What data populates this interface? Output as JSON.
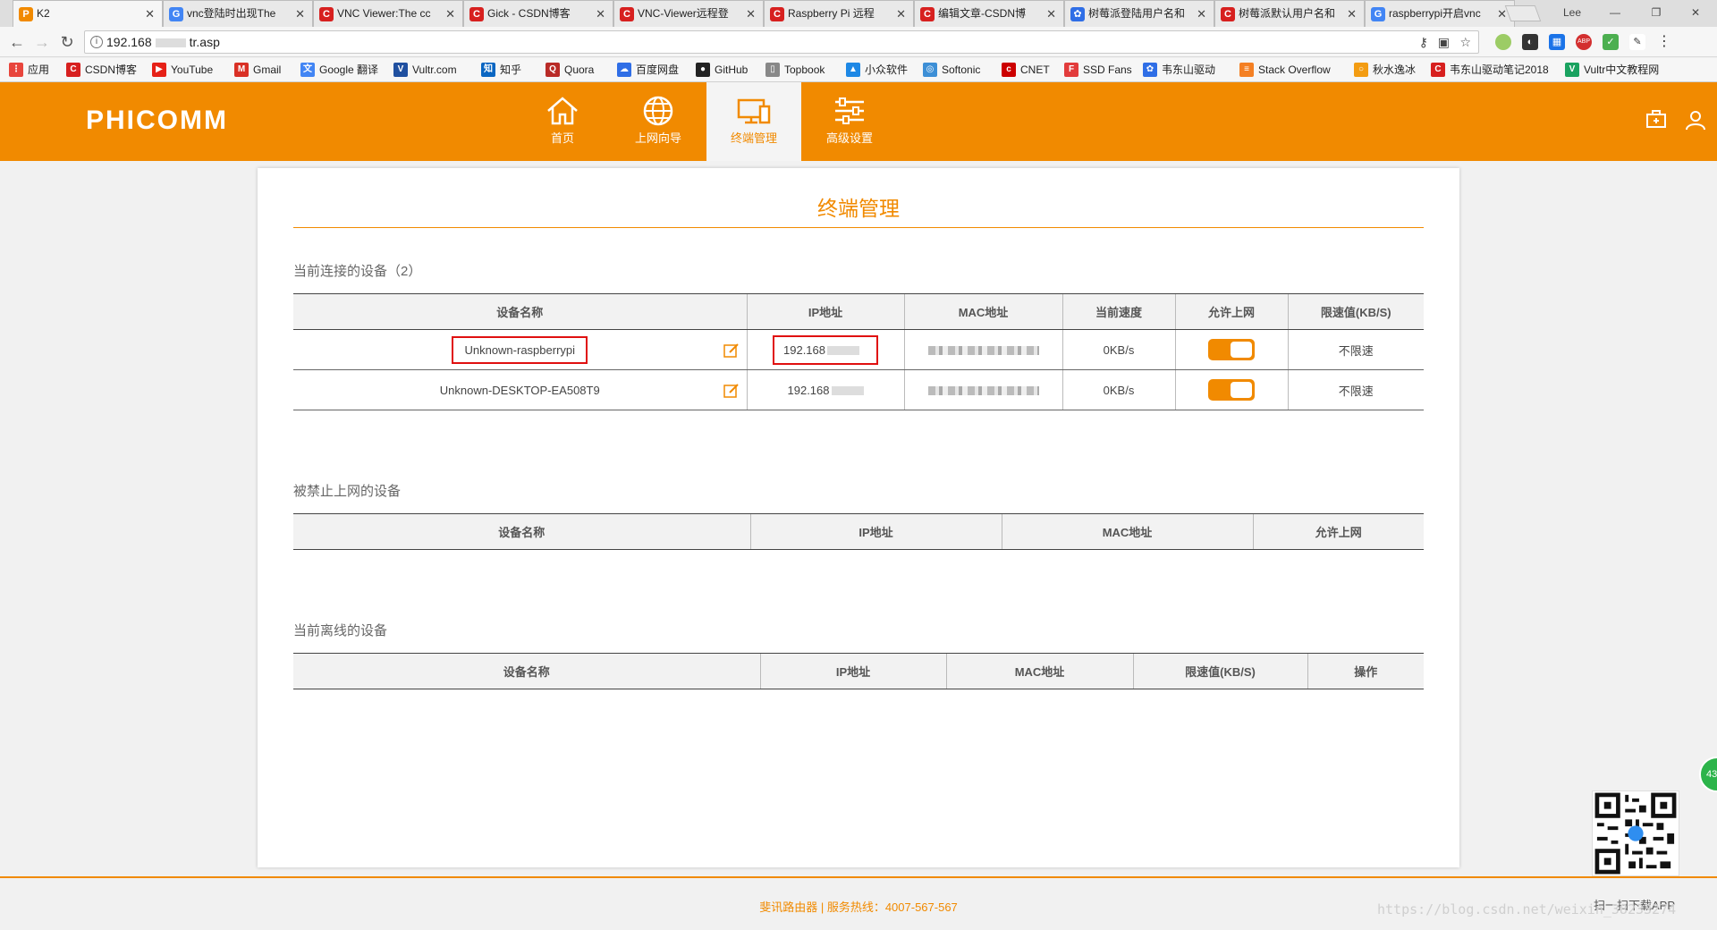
{
  "browser": {
    "tabs": [
      {
        "title": "K2",
        "icon": "phicomm-p-icon",
        "color": "#f18a00",
        "glyph": "P"
      },
      {
        "title": "vnc登陆时出现The",
        "icon": "google-g-icon",
        "color": "#4285f4",
        "glyph": "G"
      },
      {
        "title": "VNC Viewer:The cc",
        "icon": "csdn-c-icon",
        "color": "#d7201f",
        "glyph": "C"
      },
      {
        "title": "Gick - CSDN博客",
        "icon": "csdn-c-icon",
        "color": "#d7201f",
        "glyph": "C"
      },
      {
        "title": "VNC-Viewer远程登",
        "icon": "csdn-c-icon",
        "color": "#d7201f",
        "glyph": "C"
      },
      {
        "title": "Raspberry Pi 远程",
        "icon": "csdn-c-icon",
        "color": "#d7201f",
        "glyph": "C"
      },
      {
        "title": "编辑文章-CSDN博",
        "icon": "csdn-c-icon",
        "color": "#d7201f",
        "glyph": "C"
      },
      {
        "title": "树莓派登陆用户名和",
        "icon": "baidu-paw-icon",
        "color": "#2f6ee6",
        "glyph": "✿"
      },
      {
        "title": "树莓派默认用户名和",
        "icon": "csdn-c-icon",
        "color": "#d7201f",
        "glyph": "C"
      },
      {
        "title": "raspberrypi开启vnc",
        "icon": "google-g-icon",
        "color": "#4285f4",
        "glyph": "G"
      }
    ],
    "profile": "Lee",
    "url_prefix": "192.168",
    "url_suffix": "tr.asp",
    "bookmarks": [
      {
        "label": "应用",
        "icon": "apps-grid-icon",
        "color": "#e8453c",
        "glyph": "⋮"
      },
      {
        "label": "CSDN博客",
        "icon": "csdn-c-icon",
        "color": "#d7201f",
        "glyph": "C"
      },
      {
        "label": "YouTube",
        "icon": "youtube-icon",
        "color": "#e62117",
        "glyph": "▶"
      },
      {
        "label": "Gmail",
        "icon": "gmail-icon",
        "color": "#d93025",
        "glyph": "M"
      },
      {
        "label": "Google 翻译",
        "icon": "translate-icon",
        "color": "#4285f4",
        "glyph": "文"
      },
      {
        "label": "Vultr.com",
        "icon": "vultr-icon",
        "color": "#2050a0",
        "glyph": "V"
      },
      {
        "label": "知乎",
        "icon": "zhihu-icon",
        "color": "#0a66c2",
        "glyph": "知"
      },
      {
        "label": "Quora",
        "icon": "quora-icon",
        "color": "#b92b27",
        "glyph": "Q"
      },
      {
        "label": "百度网盘",
        "icon": "baidu-pan-icon",
        "color": "#2f6ee6",
        "glyph": "☁"
      },
      {
        "label": "GitHub",
        "icon": "github-icon",
        "color": "#222222",
        "glyph": "●"
      },
      {
        "label": "Topbook",
        "icon": "page-icon",
        "color": "#888888",
        "glyph": "▯"
      },
      {
        "label": "小众软件",
        "icon": "appinn-icon",
        "color": "#1e88e5",
        "glyph": "▲"
      },
      {
        "label": "Softonic",
        "icon": "softonic-icon",
        "color": "#3d8fd6",
        "glyph": "◎"
      },
      {
        "label": "CNET",
        "icon": "cnet-icon",
        "color": "#cc0000",
        "glyph": "c"
      },
      {
        "label": "SSD Fans",
        "icon": "ssdfans-icon",
        "color": "#e23c3c",
        "glyph": "F"
      },
      {
        "label": "韦东山驱动",
        "icon": "baidu-paw-icon",
        "color": "#2f6ee6",
        "glyph": "✿"
      },
      {
        "label": "Stack Overflow",
        "icon": "stackoverflow-icon",
        "color": "#f48024",
        "glyph": "≡"
      },
      {
        "label": "秋水逸冰",
        "icon": "circle-icon",
        "color": "#f39c12",
        "glyph": "○"
      },
      {
        "label": "韦东山驱动笔记2018",
        "icon": "csdn-c-icon",
        "color": "#d7201f",
        "glyph": "C"
      },
      {
        "label": "Vultr中文教程网",
        "icon": "vultr-cn-icon",
        "color": "#1aa260",
        "glyph": "V"
      }
    ]
  },
  "router": {
    "logo": "PHICOMM",
    "nav": [
      {
        "label": "首页",
        "icon": "home-icon",
        "active": false
      },
      {
        "label": "上网向导",
        "icon": "globe-icon",
        "active": false
      },
      {
        "label": "终端管理",
        "icon": "devices-icon",
        "active": true
      },
      {
        "label": "高级设置",
        "icon": "sliders-icon",
        "active": false
      }
    ],
    "accent": "#f18a00"
  },
  "page": {
    "title": "终端管理",
    "connected": {
      "title": "当前连接的设备（2）",
      "headers": [
        "设备名称",
        "IP地址",
        "MAC地址",
        "当前速度",
        "允许上网",
        "限速值(KB/S)"
      ],
      "rows": [
        {
          "name": "Unknown-raspberrypi",
          "ip": "192.168",
          "speed": "0KB/s",
          "allow": true,
          "limit": "不限速"
        },
        {
          "name": "Unknown-DESKTOP-EA508T9",
          "ip": "192.168",
          "speed": "0KB/s",
          "allow": true,
          "limit": "不限速"
        }
      ]
    },
    "blocked": {
      "title": "被禁止上网的设备",
      "headers": [
        "设备名称",
        "IP地址",
        "MAC地址",
        "允许上网"
      ]
    },
    "offline": {
      "title": "当前离线的设备",
      "headers": [
        "设备名称",
        "IP地址",
        "MAC地址",
        "限速值(KB/S)",
        "操作"
      ]
    }
  },
  "footer": {
    "text": "斐讯路由器 | 服务热线：4007-567-567",
    "qr_caption": "扫一扫下载APP",
    "watermark": "https://blog.csdn.net/weixin_38233274",
    "side_badge": "43"
  }
}
